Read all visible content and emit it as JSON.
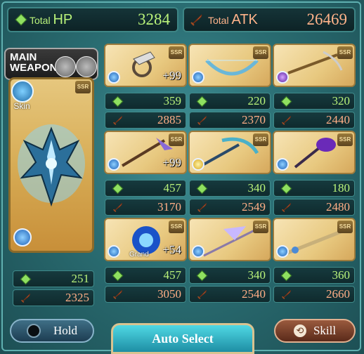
{
  "totals": {
    "hp_label_small": "Total",
    "hp_label_big": "HP",
    "hp_value": "3284",
    "atk_label_small": "Total",
    "atk_label_big": "ATK",
    "atk_value": "26469"
  },
  "main_weapon": {
    "label_line1": "MAIN",
    "label_line2": "WEAPON",
    "skin_label": "Skin",
    "rarity": "SSR",
    "element": "water",
    "hp": "251",
    "atk": "2325"
  },
  "grid": [
    {
      "rarity": "SSR",
      "element": "water",
      "plus": "+99",
      "hp": "359",
      "atk": "2885",
      "grand": ""
    },
    {
      "rarity": "SSR",
      "element": "water",
      "plus": "",
      "hp": "220",
      "atk": "2370",
      "grand": ""
    },
    {
      "rarity": "SSR",
      "element": "dark",
      "plus": "",
      "hp": "320",
      "atk": "2440",
      "grand": ""
    },
    {
      "rarity": "SSR",
      "element": "water",
      "plus": "+99",
      "hp": "457",
      "atk": "3170",
      "grand": ""
    },
    {
      "rarity": "SSR",
      "element": "light",
      "plus": "",
      "hp": "340",
      "atk": "2549",
      "grand": ""
    },
    {
      "rarity": "SSR",
      "element": "water",
      "plus": "",
      "hp": "180",
      "atk": "2480",
      "grand": ""
    },
    {
      "rarity": "SSR",
      "element": "water",
      "plus": "+54",
      "hp": "457",
      "atk": "3050",
      "grand": "Grand"
    },
    {
      "rarity": "SSR",
      "element": "water",
      "plus": "",
      "hp": "340",
      "atk": "2540",
      "grand": ""
    },
    {
      "rarity": "SSR",
      "element": "water",
      "plus": "",
      "hp": "360",
      "atk": "2660",
      "grand": ""
    }
  ],
  "buttons": {
    "hold": "Hold",
    "auto_select": "Auto Select",
    "skill": "Skill"
  },
  "colors": {
    "hp_text": "#b9f27a",
    "atk_text": "#ffb38a",
    "water": "#2f7fd6",
    "light": "#e8c84a",
    "dark": "#8a4ad6"
  }
}
